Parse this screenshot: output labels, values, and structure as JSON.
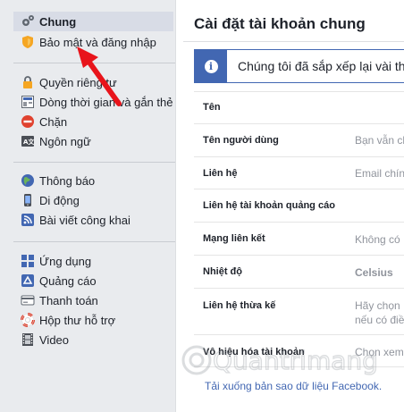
{
  "sidebar": {
    "items": [
      {
        "label": "Chung",
        "icon": "gears-icon"
      },
      {
        "label": "Bảo mật và đăng nhập",
        "icon": "shield-badge-icon"
      },
      {
        "label": "Quyền riêng tư",
        "icon": "lock-icon"
      },
      {
        "label": "Dòng thời gian và gắn thẻ",
        "icon": "timeline-icon"
      },
      {
        "label": "Chặn",
        "icon": "block-icon"
      },
      {
        "label": "Ngôn ngữ",
        "icon": "language-icon"
      },
      {
        "label": "Thông báo",
        "icon": "globe-icon"
      },
      {
        "label": "Di động",
        "icon": "mobile-icon"
      },
      {
        "label": "Bài viết công khai",
        "icon": "rss-icon"
      },
      {
        "label": "Ứng dụng",
        "icon": "apps-grid-icon"
      },
      {
        "label": "Quảng cáo",
        "icon": "ads-icon"
      },
      {
        "label": "Thanh toán",
        "icon": "credit-card-icon"
      },
      {
        "label": "Hộp thư hỗ trợ",
        "icon": "lifebuoy-icon"
      },
      {
        "label": "Video",
        "icon": "film-icon"
      }
    ]
  },
  "main": {
    "title": "Cài đặt tài khoản chung",
    "info": "Chúng tôi đã sắp xếp lại vài th",
    "rows": [
      {
        "label": "Tên",
        "value": ""
      },
      {
        "label": "Tên người dùng",
        "value": "Bạn vẫn ch"
      },
      {
        "label": "Liên hệ",
        "value": "Email chín"
      },
      {
        "label": "Liên hệ tài khoản quảng cáo",
        "value": ""
      },
      {
        "label": "Mạng liên kết",
        "value": "Không có"
      },
      {
        "label": "Nhiệt độ",
        "value": "Celsius"
      },
      {
        "label": "Liên hệ thừa kế",
        "value": "Hãy chọn",
        "value2": "nếu có điề"
      },
      {
        "label": "Vô hiệu hóa tài khoản",
        "value": "Chọn xem"
      }
    ],
    "footer_link": "Tải xuống bản sao dữ liệu Facebook."
  },
  "watermark": {
    "text": "Quantrimang"
  },
  "colors": {
    "accent": "#4267b2",
    "arrow": "#e8141b",
    "selected_bg": "#d8dce6",
    "page_bg": "#e9ebee"
  }
}
